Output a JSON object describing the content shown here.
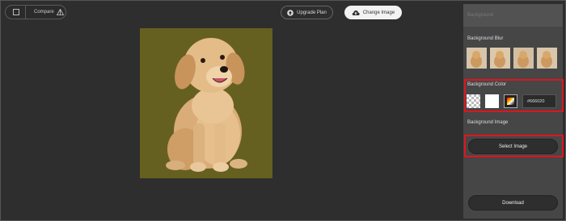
{
  "toolbar": {
    "compare_label": "Compare",
    "compare_icon": "compare-triangle-icon",
    "upgrade_label": "Upgrade Plan",
    "upgrade_icon": "upgrade-arrow-icon",
    "change_image_label": "Change Image",
    "change_image_icon": "cloud-upload-icon"
  },
  "canvas": {
    "background_color": "#666020",
    "subject": "puppy-cutout"
  },
  "panel": {
    "header": "Background",
    "blur": {
      "title": "Background Blur",
      "thumbnails": [
        "blur-level-1",
        "blur-level-2",
        "blur-level-3",
        "blur-level-4"
      ]
    },
    "color": {
      "title": "Background Color",
      "hex_value": "#666020"
    },
    "image": {
      "title": "Background Image",
      "select_label": "Select Image"
    },
    "download_label": "Download"
  },
  "colors": {
    "highlight": "#e0141e",
    "page_bg": "#2e2e2e",
    "panel_bg": "#464646"
  }
}
